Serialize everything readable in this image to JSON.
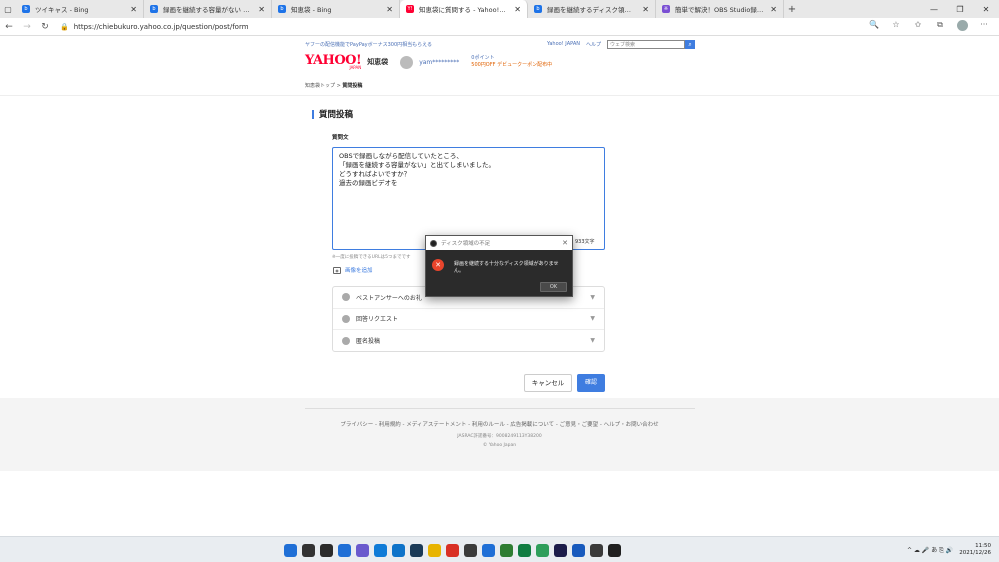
{
  "browser": {
    "tabs": [
      {
        "label": "ツイキャス - Bing",
        "fav_color": "#1e73e8",
        "fav_letter": "b",
        "active": false
      },
      {
        "label": "録画を継続する容量がない OBS",
        "fav_color": "#1e73e8",
        "fav_letter": "b",
        "active": false
      },
      {
        "label": "知恵袋 - Bing",
        "fav_color": "#1e73e8",
        "fav_letter": "b",
        "active": false
      },
      {
        "label": "知恵袋に質問する - Yahoo!知恵袋",
        "fav_color": "#ff0033",
        "fav_letter": "Y!",
        "active": true
      },
      {
        "label": "録画を継続するディスク領域がありま",
        "fav_color": "#1e73e8",
        "fav_letter": "b",
        "active": false
      },
      {
        "label": "簡単で解決！OBS Studio録画でき",
        "fav_color": "#7a4fd3",
        "fav_letter": "※",
        "active": false
      }
    ],
    "url": "https://chiebukuro.yahoo.co.jp/question/post/form"
  },
  "yj": {
    "promo": "ヤフーの配信機能でPayPayボーナス300円相当もらえる",
    "links": [
      "Yahoo! JAPAN",
      "ヘルプ"
    ],
    "search_placeholder": "ウェブ検索",
    "logo": "YAHOO!",
    "logo_sub": "JAPAN",
    "service": "知恵袋",
    "user_name": "yam*********",
    "points": "0ポイント",
    "coupon": "500円OFF デビュークーポン配布中"
  },
  "breadcrumb": {
    "root": "知恵袋トップ",
    "sep": ">",
    "current": "質問投稿"
  },
  "form": {
    "title": "質問投稿",
    "field_label": "質問文",
    "question_text": "OBSで録画しながら配信していたところ、\n「録画を継続する容量がない」と出てしまいました。\nどうすればよいですか？\n過去の録画ビデオを",
    "char_count": "933文字",
    "url_note": "※一度に投稿できるURLは5つまでです",
    "add_image": "画像を追加",
    "options": [
      {
        "label": "ベストアンサーへのお礼"
      },
      {
        "label": "回答リクエスト"
      },
      {
        "label": "匿名投稿"
      }
    ],
    "cancel": "キャンセル",
    "confirm": "確認"
  },
  "footer": {
    "links": "プライバシー - 利用規約 - メディアステートメント - 利用のルール - 広告掲載について - ご意見・ご要望 - ヘルプ・お問い合わせ",
    "jasrac": "JASRAC許諾番号：9008249113Y38200",
    "copyright": "© Yahoo Japan"
  },
  "dialog": {
    "title": "ディスク領域の不足",
    "message": "録画を継続する十分なディスク領域がありません。",
    "ok": "OK"
  },
  "taskbar": {
    "app_colors": [
      "#1f6fd6",
      "#333",
      "#2b2b2b",
      "#1f6fd6",
      "#6a5acd",
      "#0f7bd7",
      "#0e73c9",
      "#1b3a57",
      "#e8b400",
      "#d93025",
      "#3b3b3b",
      "#1f6fd6",
      "#2e7d32",
      "#107c41",
      "#2e9e5b",
      "#1c1c4a",
      "#185abd",
      "#3a3a3a",
      "#202020"
    ],
    "tray": "^ ☁ 🎤 あ ⎘ 🔊",
    "time": "11:50",
    "date": "2021/12/26"
  }
}
